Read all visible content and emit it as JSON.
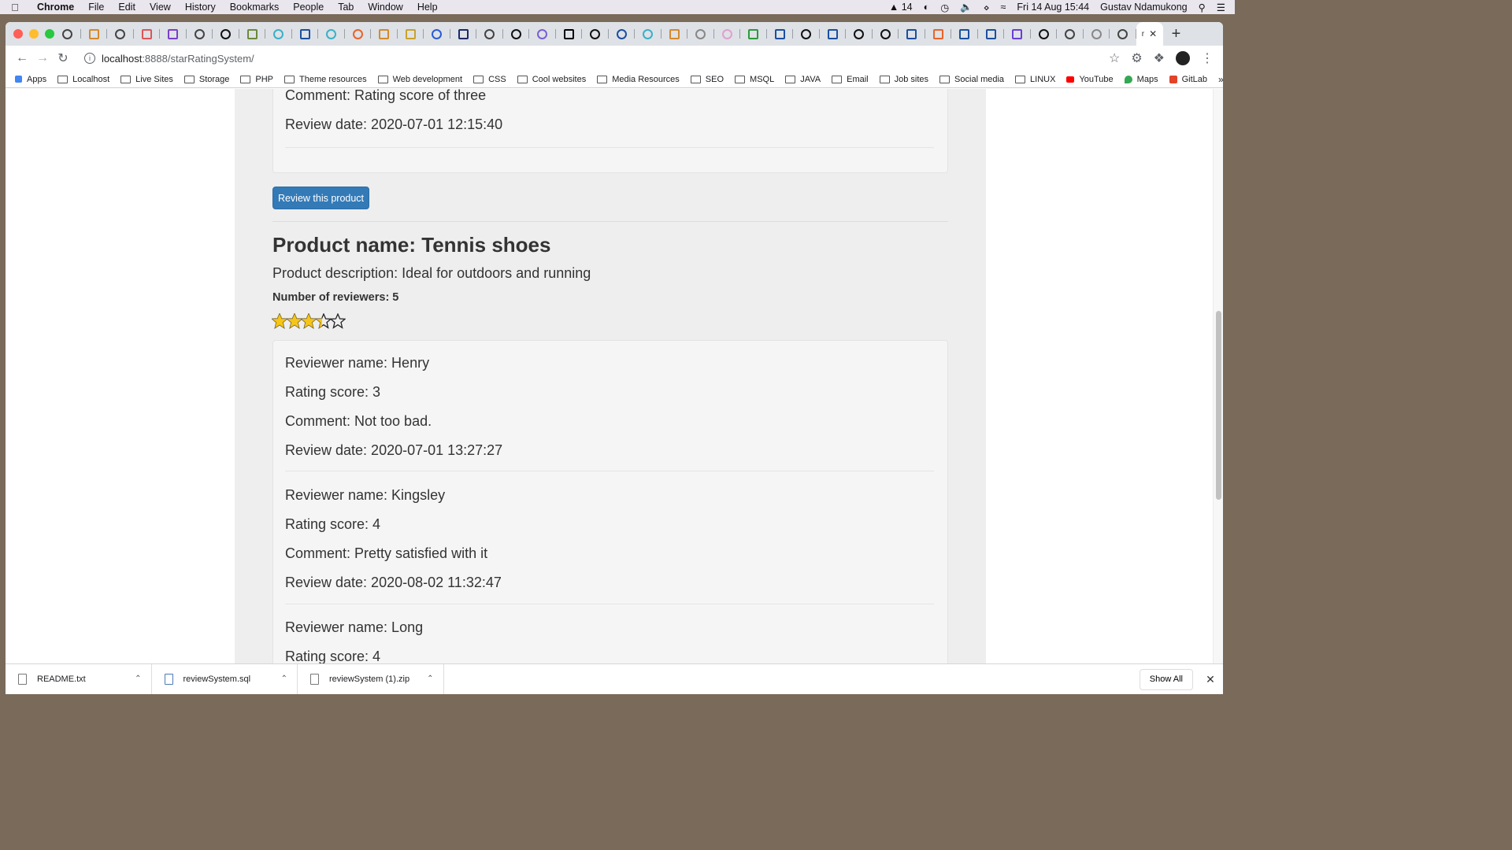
{
  "menubar": {
    "app": "Chrome",
    "items": [
      "File",
      "Edit",
      "View",
      "History",
      "Bookmarks",
      "People",
      "Tab",
      "Window",
      "Help"
    ],
    "status_count": "14",
    "datetime": "Fri 14 Aug  15:44",
    "user": "Gustav Ndamukong"
  },
  "browser": {
    "url_host": "localhost",
    "url_rest": ":8888/starRatingSystem/",
    "new_tab": "+",
    "active_tab_label": "r"
  },
  "bookmarks": [
    "Apps",
    "Localhost",
    "Live Sites",
    "Storage",
    "PHP",
    "Theme resources",
    "Web development",
    "CSS",
    "Cool websites",
    "Media Resources",
    "SEO",
    "MSQL",
    "JAVA",
    "Email",
    "Job sites",
    "Social media",
    "LINUX",
    "YouTube",
    "Maps",
    "GitLab"
  ],
  "page": {
    "prev_card": {
      "comment": "Comment: Rating score of three",
      "date": "Review date: 2020-07-01 12:15:40"
    },
    "review_button": "Review this product",
    "product": {
      "name": "Product name: Tennis shoes",
      "description": "Product description: Ideal for outdoors and running",
      "reviewers": "Number of reviewers: 5",
      "rating": 3.4,
      "max_rating": 5
    },
    "reviews": [
      {
        "name": "Reviewer name: Henry",
        "score": "Rating score: 3",
        "comment": "Comment: Not too bad.",
        "date": "Review date: 2020-07-01 13:27:27"
      },
      {
        "name": "Reviewer name: Kingsley",
        "score": "Rating score: 4",
        "comment": "Comment: Pretty satisfied with it",
        "date": "Review date: 2020-08-02 11:32:47"
      },
      {
        "name": "Reviewer name: Long",
        "score": "Rating score: 4"
      }
    ]
  },
  "downloads": {
    "items": [
      "README.txt",
      "reviewSystem.sql",
      "reviewSystem (1).zip"
    ],
    "show_all": "Show All"
  },
  "colors": {
    "button": "#337ab7",
    "star": "#f5c518",
    "container_bg": "#eeeeee"
  }
}
